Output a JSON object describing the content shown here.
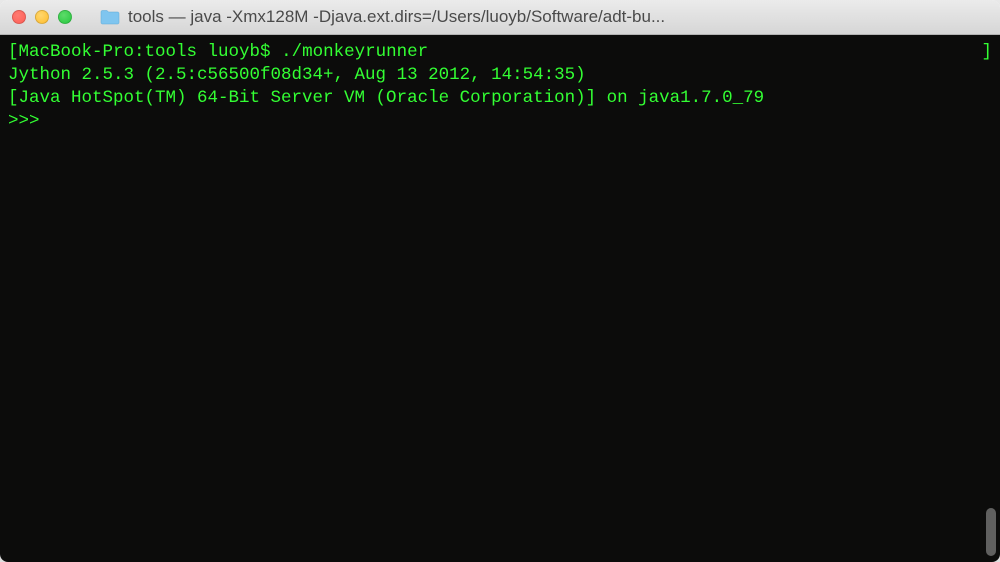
{
  "titlebar": {
    "title": "tools — java -Xmx128M -Djava.ext.dirs=/Users/luoyb/Software/adt-bu..."
  },
  "terminal": {
    "line1_prefix": "[",
    "line1_host": "MacBook-Pro:tools luoyb$ ",
    "line1_cmd": "./monkeyrunner",
    "line1_suffix_bracket": "]",
    "line2": "Jython 2.5.3 (2.5:c56500f08d34+, Aug 13 2012, 14:54:35) ",
    "line3": "[Java HotSpot(TM) 64-Bit Server VM (Oracle Corporation)] on java1.7.0_79",
    "line4": ">>> "
  }
}
